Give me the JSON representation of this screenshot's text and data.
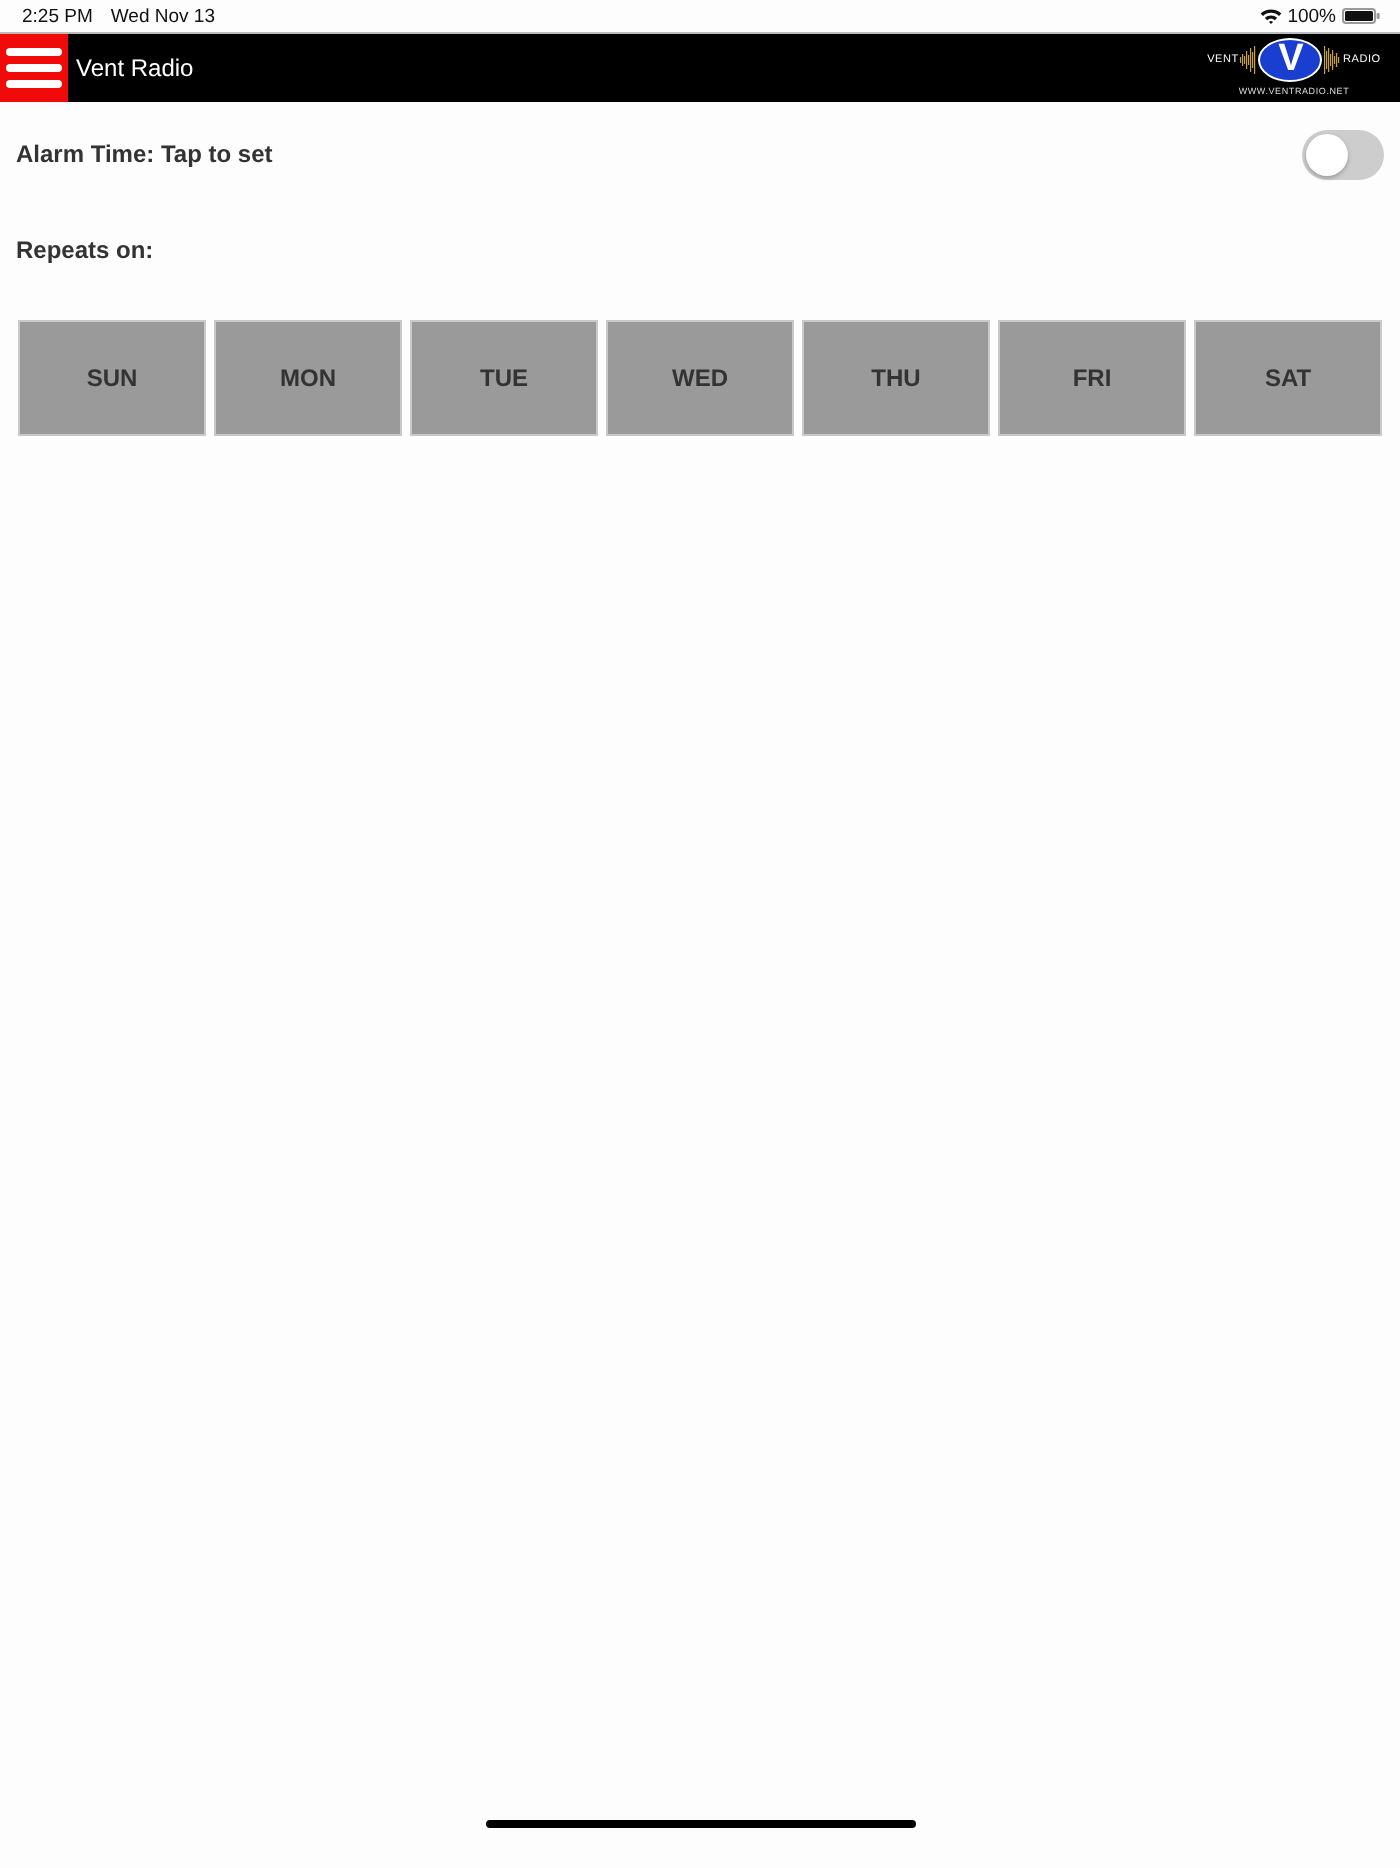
{
  "status_bar": {
    "time": "2:25 PM",
    "date": "Wed Nov 13",
    "battery": "100%"
  },
  "header": {
    "title": "Vent Radio",
    "logo": {
      "left_word": "VENT",
      "mark": "V",
      "right_word": "RADIO",
      "url": "WWW.VENTRADIO.NET"
    }
  },
  "alarm": {
    "label": "Alarm Time: Tap to set",
    "on": false
  },
  "repeats": {
    "label": "Repeats on:",
    "days": [
      {
        "label": "SUN",
        "selected": false
      },
      {
        "label": "MON",
        "selected": false
      },
      {
        "label": "TUE",
        "selected": false
      },
      {
        "label": "WED",
        "selected": false
      },
      {
        "label": "THU",
        "selected": false
      },
      {
        "label": "FRI",
        "selected": false
      },
      {
        "label": "SAT",
        "selected": false
      }
    ]
  }
}
